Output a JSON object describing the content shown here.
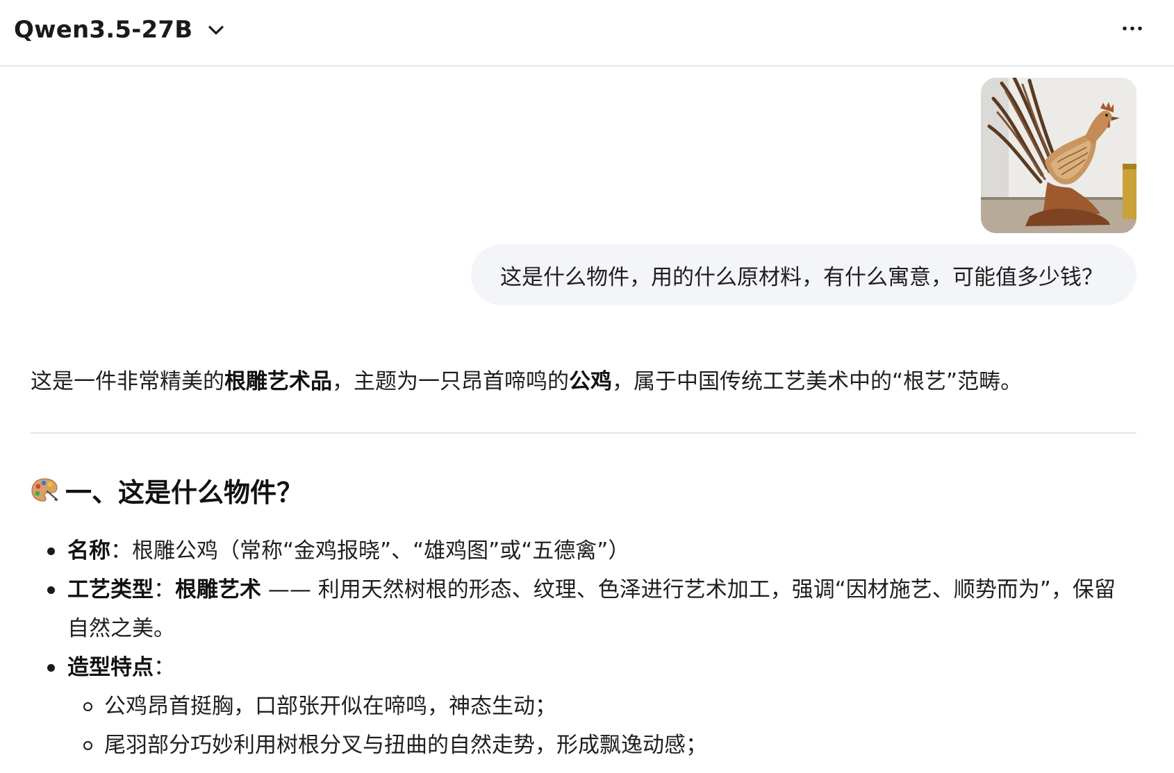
{
  "header": {
    "model_name": "Qwen3.5-27B",
    "dropdown_icon": "chevron-down-icon",
    "more_icon": "more-horizontal-icon"
  },
  "user_message": {
    "image_subject": "root-carved rooster sculpture",
    "text": "这是什么物件，用的什么原材料，有什么寓意，可能值多少钱？"
  },
  "answer": {
    "intro": {
      "t1": "这是一件非常精美的",
      "b1": "根雕艺术品",
      "t2": "，主题为一只昂首啼鸣的",
      "b2": "公鸡",
      "t3": "，属于中国传统工艺美术中的“根艺”范畴。"
    },
    "section1": {
      "icon": "artist-palette-icon",
      "title": "一、这是什么物件？"
    },
    "items": [
      {
        "label": "名称",
        "sep": "：",
        "text": "根雕公鸡（常称“金鸡报晓”、“雄鸡图”或“五德禽”）"
      },
      {
        "label": "工艺类型",
        "sep": "：",
        "bold_text": "根雕艺术",
        "text": " —— 利用天然树根的形态、纹理、色泽进行艺术加工，强调“因材施艺、顺势而为”，保留自然之美。"
      },
      {
        "label": "造型特点",
        "sep": "：",
        "subitems": [
          "公鸡昂首挺胸，口部张开似在啼鸣，神态生动；",
          "尾羽部分巧妙利用树根分叉与扭曲的自然走势，形成飘逸动感；"
        ]
      }
    ]
  }
}
